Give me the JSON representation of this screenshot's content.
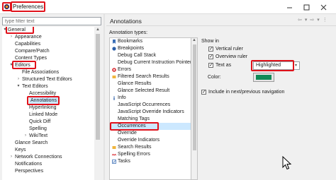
{
  "window": {
    "title": "Preferences",
    "controls": [
      "minimize-icon",
      "maximize-icon",
      "close-icon"
    ]
  },
  "filter": {
    "placeholder": "type filter text",
    "value": ""
  },
  "tree": [
    {
      "label": "General",
      "twisty": "expanded"
    },
    {
      "label": "Appearance",
      "twisty": "collapsed"
    },
    {
      "label": "Capabilities",
      "twisty": ""
    },
    {
      "label": "Compare/Patch",
      "twisty": ""
    },
    {
      "label": "Content Types",
      "twisty": ""
    },
    {
      "label": "Editors",
      "twisty": "expanded"
    },
    {
      "label": "File Associations",
      "twisty": ""
    },
    {
      "label": "Structured Text Editors",
      "twisty": "collapsed"
    },
    {
      "label": "Text Editors",
      "twisty": "expanded"
    },
    {
      "label": "Accessibility",
      "twisty": ""
    },
    {
      "label": "Annotations",
      "twisty": ""
    },
    {
      "label": "Hyperlinking",
      "twisty": ""
    },
    {
      "label": "Linked Mode",
      "twisty": ""
    },
    {
      "label": "Quick Diff",
      "twisty": ""
    },
    {
      "label": "Spelling",
      "twisty": ""
    },
    {
      "label": "WikiText",
      "twisty": "collapsed"
    },
    {
      "label": "Glance Search",
      "twisty": ""
    },
    {
      "label": "Keys",
      "twisty": ""
    },
    {
      "label": "Network Connections",
      "twisty": "collapsed"
    },
    {
      "label": "Notifications",
      "twisty": ""
    },
    {
      "label": "Perspectives",
      "twisty": ""
    }
  ],
  "page": {
    "title": "Annotations",
    "annotation_types_label": "Annotation types:"
  },
  "annotation_types": [
    {
      "label": "Bookmarks",
      "icon": "bookmark-icon"
    },
    {
      "label": "Breakpoints",
      "icon": "breakpoint-icon"
    },
    {
      "label": "Debug Call Stack",
      "icon": ""
    },
    {
      "label": "Debug Current Instruction Pointer",
      "icon": ""
    },
    {
      "label": "Errors",
      "icon": "error-icon"
    },
    {
      "label": "Filtered Search Results",
      "icon": "search-result-icon"
    },
    {
      "label": "Glance Results",
      "icon": ""
    },
    {
      "label": "Glance Selected Result",
      "icon": ""
    },
    {
      "label": "Info",
      "icon": "info-icon"
    },
    {
      "label": "JavaScript Occurrences",
      "icon": ""
    },
    {
      "label": "JavaScript Override Indicators",
      "icon": ""
    },
    {
      "label": "Matching Tags",
      "icon": ""
    },
    {
      "label": "Occurrences",
      "icon": "",
      "selected": true
    },
    {
      "label": "Override",
      "icon": ""
    },
    {
      "label": "Override Indicators",
      "icon": ""
    },
    {
      "label": "Search Results",
      "icon": "search-result-icon"
    },
    {
      "label": "Spelling Errors",
      "icon": "spelling-error-icon"
    },
    {
      "label": "Tasks",
      "icon": "task-icon"
    }
  ],
  "options": {
    "show_in_label": "Show in",
    "vertical_ruler": {
      "label": "Vertical ruler",
      "checked": true
    },
    "overview_ruler": {
      "label": "Overview ruler",
      "checked": true
    },
    "text_as": {
      "label": "Text as",
      "checked": true,
      "value": "Highlighted"
    },
    "color_label": "Color:",
    "color": "#108a57",
    "include_nav": {
      "label": "Include in next/previous navigation",
      "checked": true
    }
  },
  "colors": {
    "highlight_box": "#e0121b",
    "selection": "#cce8ff"
  }
}
